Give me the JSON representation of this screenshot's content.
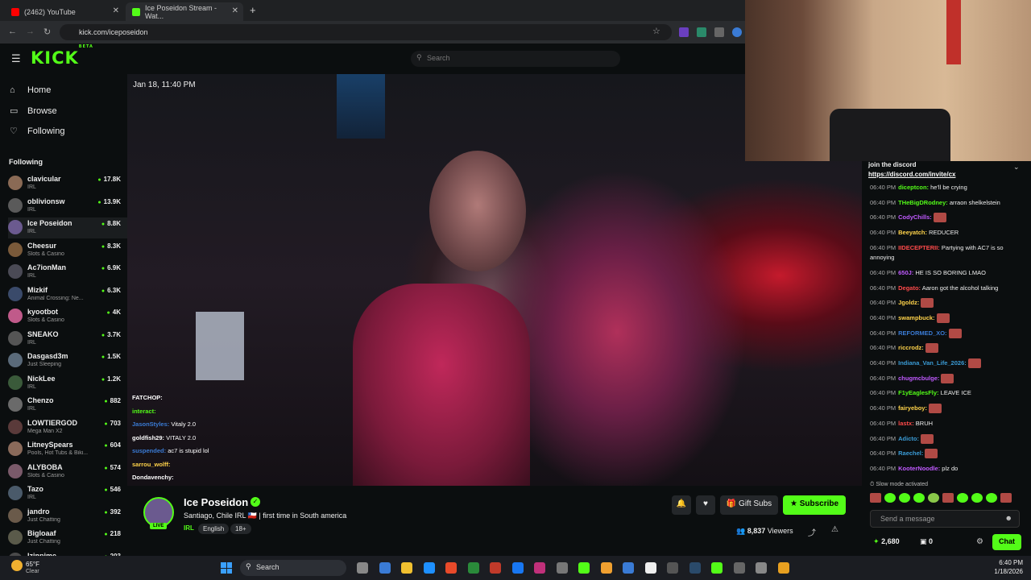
{
  "browser": {
    "tabs": [
      {
        "label": "(2462) YouTube",
        "fav_color": "#ff0000"
      },
      {
        "label": "Ice Poseidon Stream - Wat...",
        "fav_color": "#53fc18"
      }
    ],
    "url": "kick.com/iceposeidon"
  },
  "site": {
    "logo": "KICK",
    "logo_badge": "BETA",
    "search_placeholder": "Search"
  },
  "sidebar": {
    "nav": [
      {
        "label": "Home",
        "icon": "home-icon",
        "glyph": "⌂"
      },
      {
        "label": "Browse",
        "icon": "browse-icon",
        "glyph": "▭"
      },
      {
        "label": "Following",
        "icon": "heart-icon",
        "glyph": "♡"
      }
    ],
    "following_heading": "Following",
    "channels": [
      {
        "name": "clavicular",
        "category": "IRL",
        "viewers": "17.8K",
        "color": "#8a6a55"
      },
      {
        "name": "oblivionsw",
        "category": "IRL",
        "viewers": "13.9K",
        "color": "#5a5a5a"
      },
      {
        "name": "Ice Poseidon",
        "category": "IRL",
        "viewers": "8.8K",
        "color": "#6b5a8f"
      },
      {
        "name": "Cheesur",
        "category": "Slots & Casino",
        "viewers": "8.3K",
        "color": "#7a5a3a"
      },
      {
        "name": "Ac7ionMan",
        "category": "IRL",
        "viewers": "6.9K",
        "color": "#4a4a55"
      },
      {
        "name": "Mizkif",
        "category": "Animal Crossing: Ne...",
        "viewers": "6.3K",
        "color": "#3a4a6a"
      },
      {
        "name": "kyootbot",
        "category": "Slots & Casino",
        "viewers": "4K",
        "color": "#c05a8a"
      },
      {
        "name": "SNEAKO",
        "category": "IRL",
        "viewers": "3.7K",
        "color": "#555555"
      },
      {
        "name": "Dasgasd3m",
        "category": "Just Sleeping",
        "viewers": "1.5K",
        "color": "#5a6a7a"
      },
      {
        "name": "NickLee",
        "category": "IRL",
        "viewers": "1.2K",
        "color": "#3a5a3a"
      },
      {
        "name": "Chenzo",
        "category": "IRL",
        "viewers": "882",
        "color": "#6a6a6a"
      },
      {
        "name": "LOWTIERGOD",
        "category": "Mega Man X2",
        "viewers": "703",
        "color": "#5a3a3a"
      },
      {
        "name": "LitneySpears",
        "category": "Pools, Hot Tubs & Biki...",
        "viewers": "604",
        "color": "#8a6a5a"
      },
      {
        "name": "ALYBOBA",
        "category": "Slots & Casino",
        "viewers": "574",
        "color": "#7a5a6a"
      },
      {
        "name": "Tazo",
        "category": "IRL",
        "viewers": "546",
        "color": "#4a5a6a"
      },
      {
        "name": "jandro",
        "category": "Just Chatting",
        "viewers": "392",
        "color": "#6a5a4a"
      },
      {
        "name": "Bigloaaf",
        "category": "Just Chatting",
        "viewers": "218",
        "color": "#5a5a4a"
      },
      {
        "name": "Izinpime",
        "category": "",
        "viewers": "203",
        "color": "#4a4a4a"
      }
    ]
  },
  "video": {
    "date": "Jan 18, 11:40 PM",
    "overlay_chat": [
      {
        "user": "FATCHOP:",
        "msg": "",
        "color": "#ffffff"
      },
      {
        "user": "interact:",
        "msg": "",
        "color": "#53fc18"
      },
      {
        "user": "JasonStyles:",
        "msg": "Vitaly 2.0",
        "color": "#3a7bd5"
      },
      {
        "user": "goldfish29:",
        "msg": "VITALY 2.0",
        "color": "#ffffff"
      },
      {
        "user": "suspended:",
        "msg": "ac7 is stupid lol",
        "color": "#3a7bd5"
      },
      {
        "user": "sarrou_wolff:",
        "msg": "",
        "color": "#ffd34a"
      },
      {
        "user": "Dondavenchy:",
        "msg": "",
        "color": "#ffffff"
      }
    ]
  },
  "chat": {
    "pinned_title": "join the discord",
    "pinned_link": "https://discord.com/invite/cx",
    "messages": [
      {
        "time": "06:40 PM",
        "user": "diceptcon:",
        "msg": "he'll be crying",
        "color": "#53fc18",
        "emote": false
      },
      {
        "time": "06:40 PM",
        "user": "THeBigDRodney:",
        "msg": "arraon shelkelstein",
        "color": "#53fc18",
        "emote": false
      },
      {
        "time": "06:40 PM",
        "user": "CodyChills:",
        "msg": "",
        "color": "#c05aff",
        "emote": true
      },
      {
        "time": "06:40 PM",
        "user": "Beeyatch:",
        "msg": "REDUCER",
        "color": "#ffd34a",
        "emote": false
      },
      {
        "time": "06:40 PM",
        "user": "IIDECEPTERII:",
        "msg": "Partying with AC7 is so annoying",
        "color": "#ff4a4a",
        "emote": false
      },
      {
        "time": "06:40 PM",
        "user": "650J:",
        "msg": "HE IS SO BORING LMAO",
        "color": "#c05aff",
        "emote": false
      },
      {
        "time": "06:40 PM",
        "user": "Degato:",
        "msg": "Aaron got the alcohol talking",
        "color": "#ff4a4a",
        "emote": false
      },
      {
        "time": "06:40 PM",
        "user": "Jgoldz:",
        "msg": "",
        "color": "#ffd34a",
        "emote": true
      },
      {
        "time": "06:40 PM",
        "user": "swampbuck:",
        "msg": "",
        "color": "#ffd34a",
        "emote": true
      },
      {
        "time": "06:40 PM",
        "user": "REFORMED_XO:",
        "msg": "",
        "color": "#3a7bd5",
        "emote": true
      },
      {
        "time": "06:40 PM",
        "user": "riccrodz:",
        "msg": "",
        "color": "#ffd34a",
        "emote": true
      },
      {
        "time": "06:40 PM",
        "user": "Indiana_Van_Life_2026:",
        "msg": "",
        "color": "#3a9bd5",
        "emote": true
      },
      {
        "time": "06:40 PM",
        "user": "chugmcbulge:",
        "msg": "",
        "color": "#c05aff",
        "emote": true
      },
      {
        "time": "06:40 PM",
        "user": "F1yEaglesFly:",
        "msg": "LEAVE ICE",
        "color": "#53fc18",
        "emote": false
      },
      {
        "time": "06:40 PM",
        "user": "fairyeboy:",
        "msg": "",
        "color": "#ffd34a",
        "emote": true
      },
      {
        "time": "06:40 PM",
        "user": "lastx:",
        "msg": "BRUH",
        "color": "#ff4a4a",
        "emote": false
      },
      {
        "time": "06:40 PM",
        "user": "Adicto:",
        "msg": "",
        "color": "#3a9bd5",
        "emote": true
      },
      {
        "time": "06:40 PM",
        "user": "Raechel:",
        "msg": "",
        "color": "#3a9bd5",
        "emote": true
      },
      {
        "time": "06:40 PM",
        "user": "KooterNoodle:",
        "msg": "plz do",
        "color": "#c05aff",
        "emote": false
      }
    ],
    "slow_mode": "Slow mode activated",
    "send_placeholder": "Send a message",
    "points": "2,680",
    "points_secondary": "0",
    "chat_button": "Chat"
  },
  "streamer": {
    "name": "Ice Poseidon",
    "live_badge": "LIVE",
    "title": "Santiago, Chile IRL 🇨🇱 | first time in South america",
    "category": "IRL",
    "tags": [
      "English",
      "18+"
    ],
    "gift_subs": "Gift Subs",
    "subscribe": "Subscribe",
    "viewers": "8,837",
    "viewers_label": "Viewers"
  },
  "taskbar": {
    "weather_temp": "65°F",
    "weather_desc": "Clear",
    "search": "Search",
    "time": "6:40 PM",
    "date": "1/18/2026"
  }
}
